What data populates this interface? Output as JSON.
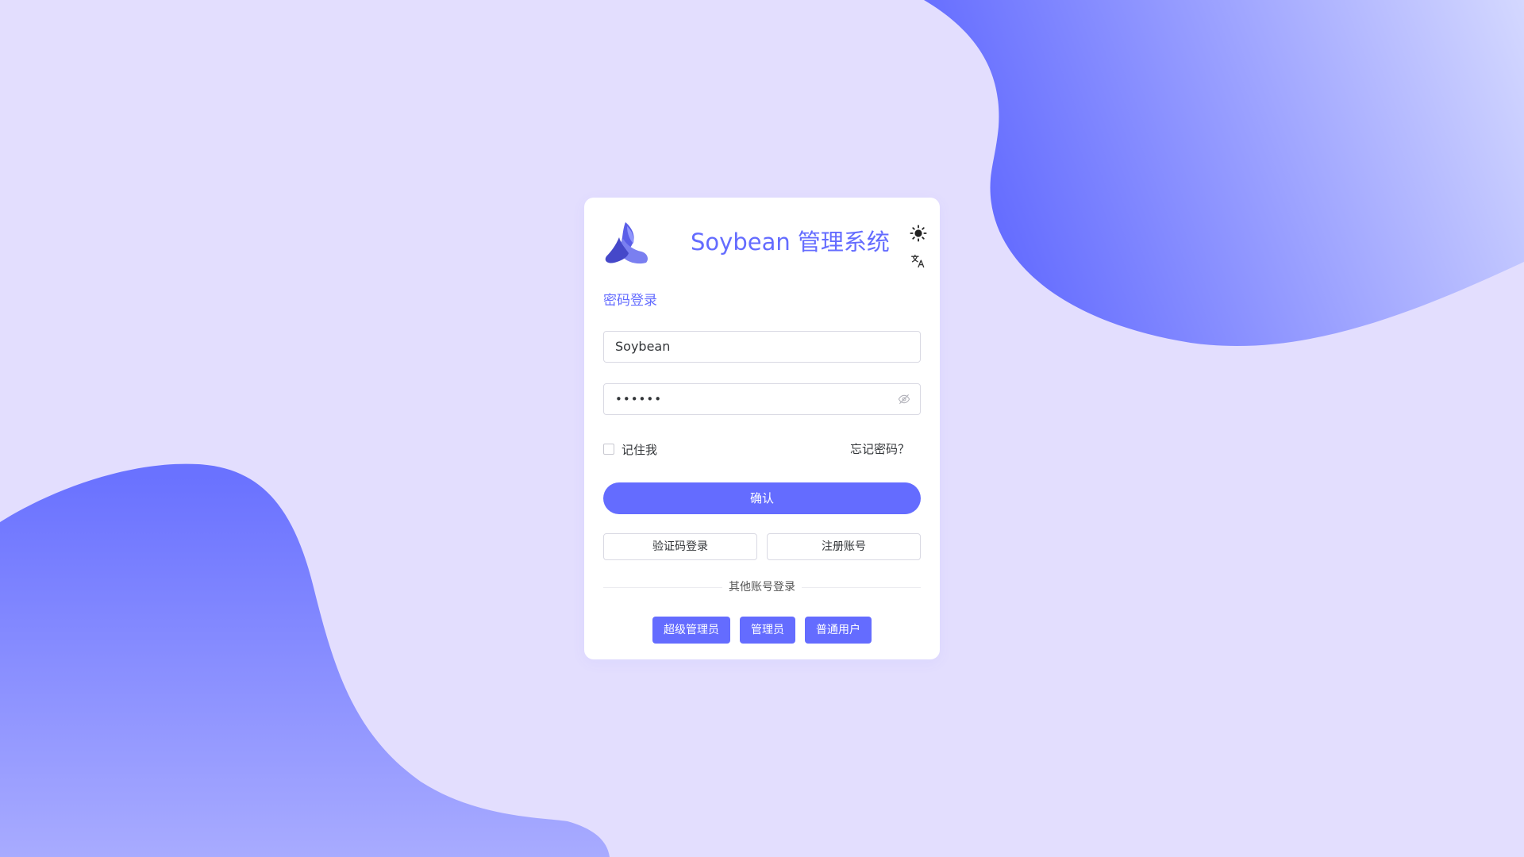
{
  "header": {
    "title": "Soybean 管理系统",
    "logo_icon": "soybean-logo",
    "theme_icon": "sun-icon",
    "lang_icon": "translate-icon"
  },
  "login": {
    "title": "密码登录",
    "username_value": "Soybean",
    "password_value": "••••••",
    "remember_label": "记住我",
    "forgot_label": "忘记密码？",
    "confirm_label": "确认",
    "code_login_label": "验证码登录",
    "register_label": "注册账号",
    "other_accounts_label": "其他账号登录",
    "roles": [
      "超级管理员",
      "管理员",
      "普通用户"
    ]
  },
  "colors": {
    "primary": "#646cff",
    "background": "#e3defe",
    "card": "#ffffff"
  }
}
